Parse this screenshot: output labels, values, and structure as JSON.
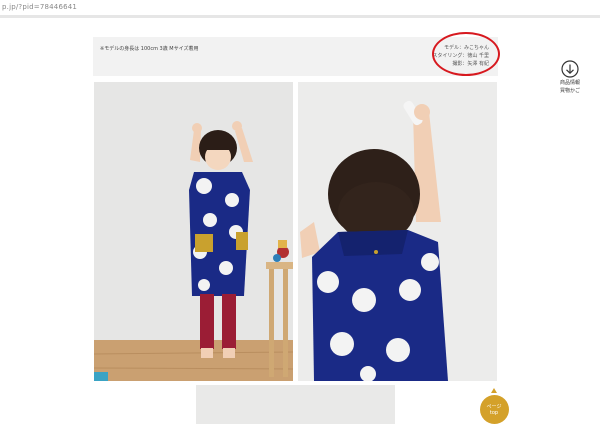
{
  "browser": {
    "url_fragment": "p.jp/?pid=78446641"
  },
  "notice": {
    "model_height": "※モデルの身長は 100cm 3歳 Mサイズ着用",
    "credits": [
      "モデル：みこちゃん",
      "スタイリング：徳山 千里",
      "撮影：矢澤 有紀"
    ]
  },
  "side_link": {
    "label_line1": "商品情報",
    "label_line2": "買物かご"
  },
  "to_top": {
    "line1": "ページ",
    "line2": "top"
  },
  "colors": {
    "accent_gold": "#d4a12a",
    "annotation_red": "#d7191f",
    "navy_dress": "#1a2a86"
  }
}
